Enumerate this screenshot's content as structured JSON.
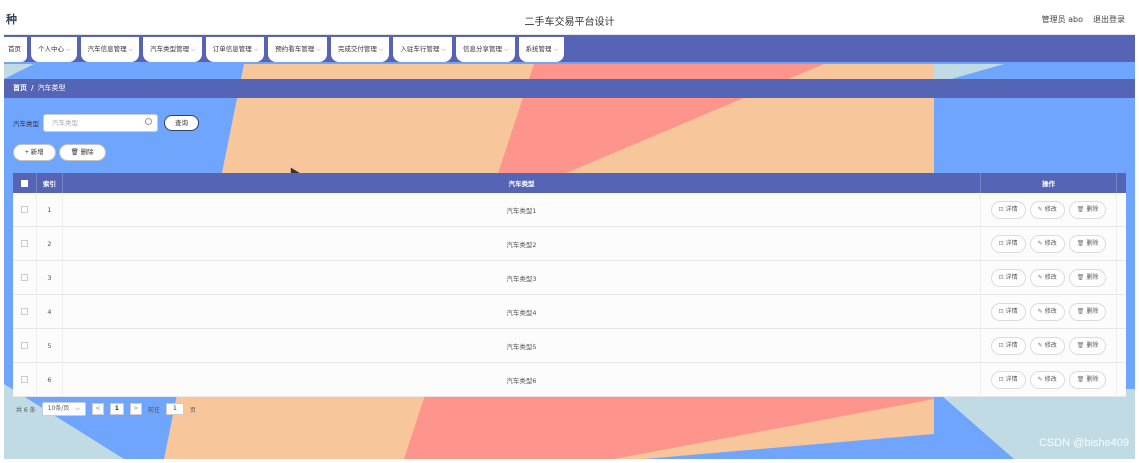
{
  "app": {
    "logo_text": "种",
    "title": "二手车交易平台设计",
    "user_label": "管理员 abo",
    "logout_label": "退出登录"
  },
  "nav": [
    {
      "label": "首页",
      "has_caret": false
    },
    {
      "label": "个人中心",
      "has_caret": true
    },
    {
      "label": "汽车信息管理",
      "has_caret": true
    },
    {
      "label": "汽车类型管理",
      "has_caret": true
    },
    {
      "label": "订单信息管理",
      "has_caret": true
    },
    {
      "label": "预约看车管理",
      "has_caret": true
    },
    {
      "label": "完成交付管理",
      "has_caret": true
    },
    {
      "label": "入驻车行管理",
      "has_caret": true
    },
    {
      "label": "信息分享管理",
      "has_caret": true
    },
    {
      "label": "系统管理",
      "has_caret": true
    }
  ],
  "breadcrumb": {
    "home": "首页",
    "separator": "/",
    "current": "汽车类型"
  },
  "search": {
    "label": "汽车类型",
    "placeholder": "汽车类型",
    "query_button": "查询"
  },
  "actions": {
    "add_button": "+ 新增",
    "delete_button": "🗑 删除"
  },
  "table": {
    "headers": {
      "index": "索引",
      "name": "汽车类型",
      "ops": "操作"
    },
    "ops_labels": {
      "detail": "详情",
      "edit": "修改",
      "delete": "删除"
    },
    "rows": [
      {
        "index": "1",
        "name": "汽车类型1"
      },
      {
        "index": "2",
        "name": "汽车类型2"
      },
      {
        "index": "3",
        "name": "汽车类型3"
      },
      {
        "index": "4",
        "name": "汽车类型4"
      },
      {
        "index": "5",
        "name": "汽车类型5"
      },
      {
        "index": "6",
        "name": "汽车类型6"
      }
    ]
  },
  "pager": {
    "total_text": "共 6 条",
    "page_size": "10条/页",
    "prev": "<",
    "current_page": "1",
    "next": ">",
    "goto_label": "前往",
    "goto_value": "1",
    "page_suffix": "页"
  },
  "watermark": "CSDN @bishe409",
  "colors": {
    "accent": "#5664b6",
    "background": "#6fa5fd",
    "peach": "#f8c69b",
    "coral": "#fe958c",
    "pale": "#c0dbe4"
  }
}
